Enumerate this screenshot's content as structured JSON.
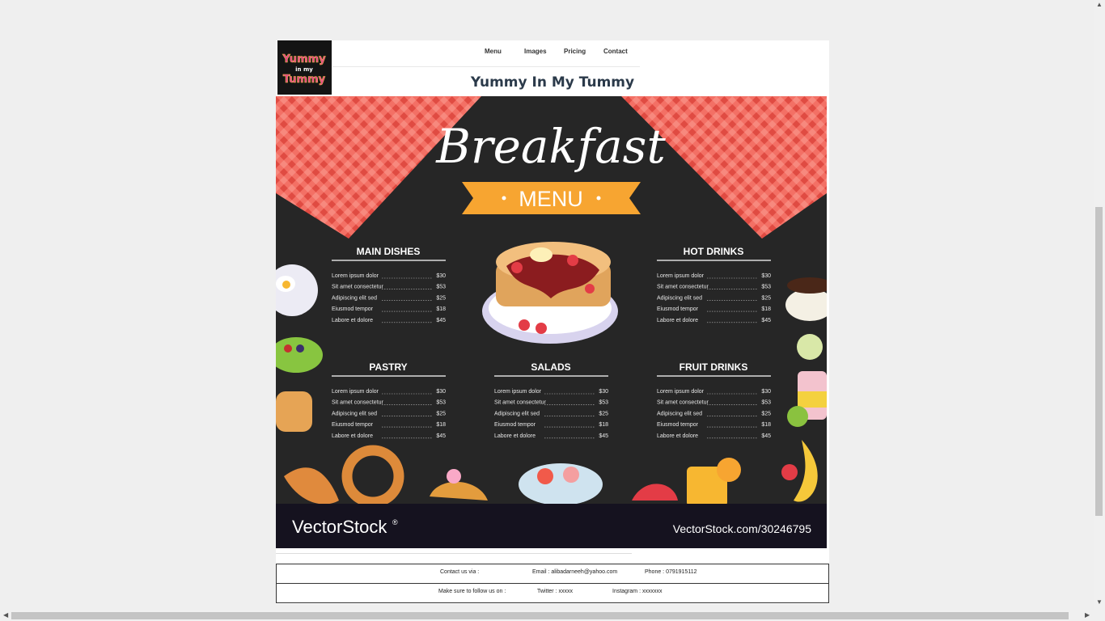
{
  "logo": {
    "line1": "Yummy",
    "line2": "in my",
    "line3": "Tummy"
  },
  "nav": {
    "items": [
      "Menu",
      "Images",
      "Pricing",
      "Contact"
    ]
  },
  "site_title": "Yummy In My Tummy",
  "poster": {
    "title": "Breakfast",
    "ribbon": "MENU",
    "sections": [
      {
        "heading": "MAIN DISHES",
        "items": [
          {
            "name": "Lorem ipsum dolor",
            "price": "$30"
          },
          {
            "name": "Sit amet consectetur",
            "price": "$53"
          },
          {
            "name": "Adipiscing elit sed",
            "price": "$25"
          },
          {
            "name": "Eiusmod tempor",
            "price": "$18"
          },
          {
            "name": "Labore et dolore",
            "price": "$45"
          }
        ]
      },
      {
        "heading": "HOT DRINKS",
        "items": [
          {
            "name": "Lorem ipsum dolor",
            "price": "$30"
          },
          {
            "name": "Sit amet consectetur",
            "price": "$53"
          },
          {
            "name": "Adipiscing elit sed",
            "price": "$25"
          },
          {
            "name": "Eiusmod tempor",
            "price": "$18"
          },
          {
            "name": "Labore et dolore",
            "price": "$45"
          }
        ]
      },
      {
        "heading": "PASTRY",
        "items": [
          {
            "name": "Lorem ipsum dolor",
            "price": "$30"
          },
          {
            "name": "Sit amet consectetur",
            "price": "$53"
          },
          {
            "name": "Adipiscing elit sed",
            "price": "$25"
          },
          {
            "name": "Eiusmod tempor",
            "price": "$18"
          },
          {
            "name": "Labore et dolore",
            "price": "$45"
          }
        ]
      },
      {
        "heading": "SALADS",
        "items": [
          {
            "name": "Lorem ipsum dolor",
            "price": "$30"
          },
          {
            "name": "Sit amet consectetur",
            "price": "$53"
          },
          {
            "name": "Adipiscing elit sed",
            "price": "$25"
          },
          {
            "name": "Eiusmod tempor",
            "price": "$18"
          },
          {
            "name": "Labore et dolore",
            "price": "$45"
          }
        ]
      },
      {
        "heading": "FRUIT DRINKS",
        "items": [
          {
            "name": "Lorem ipsum dolor",
            "price": "$30"
          },
          {
            "name": "Sit amet consectetur",
            "price": "$53"
          },
          {
            "name": "Adipiscing elit sed",
            "price": "$25"
          },
          {
            "name": "Eiusmod tempor",
            "price": "$18"
          },
          {
            "name": "Labore et dolore",
            "price": "$45"
          }
        ]
      }
    ],
    "brand": "VectorStock",
    "brand_mark": "®",
    "brand_url": "VectorStock.com/30246795"
  },
  "footer": {
    "contact_label": "Contact us via :",
    "email": "Email : alibadarneeh@yahoo.com",
    "phone": "Phone : 0791915112",
    "follow_label": "Make sure to follow us on  :",
    "twitter": "Twitter : xxxxx",
    "instagram": "Instagram : xxxxxxx"
  },
  "colors": {
    "poster_bg": "#262626",
    "checker": "#f2655a",
    "ribbon": "#f7a531",
    "banner_bg": "#15121f",
    "title_text": "#2b3a4a"
  }
}
